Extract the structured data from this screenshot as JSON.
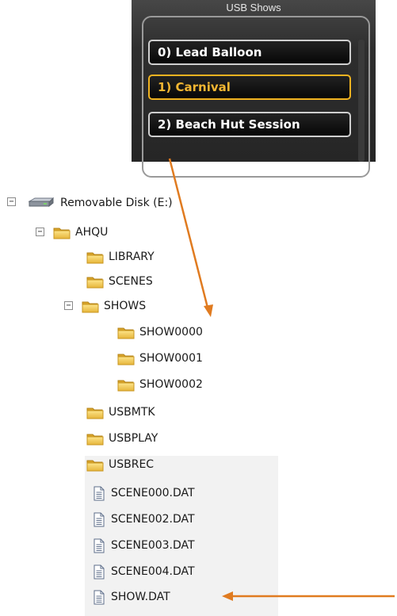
{
  "panel": {
    "title": "USB Shows",
    "shows": [
      {
        "label": "0) Lead Balloon",
        "active": false
      },
      {
        "label": "1) Carnival",
        "active": true
      },
      {
        "label": "2) Beach Hut Session",
        "active": false
      }
    ],
    "accent_color": "#f0b320"
  },
  "tree": {
    "drive": {
      "label": "Removable Disk (E:)",
      "expanded": true,
      "icon": "drive-icon"
    },
    "root": {
      "label": "AHQU",
      "expanded": true,
      "icon": "folder-icon"
    },
    "folders": {
      "library": "LIBRARY",
      "scenes": "SCENES",
      "shows": "SHOWS",
      "show0": "SHOW0000",
      "show1": "SHOW0001",
      "show2": "SHOW0002",
      "usbmtk": "USBMTK",
      "usbplay": "USBPLAY",
      "usbrec": "USBREC"
    },
    "files": {
      "f0": "SCENE000.DAT",
      "f1": "SCENE002.DAT",
      "f2": "SCENE003.DAT",
      "f3": "SCENE004.DAT",
      "f4": "SHOW.DAT"
    },
    "toggle_symbol": "−"
  },
  "annotation_color": "#e07b20"
}
